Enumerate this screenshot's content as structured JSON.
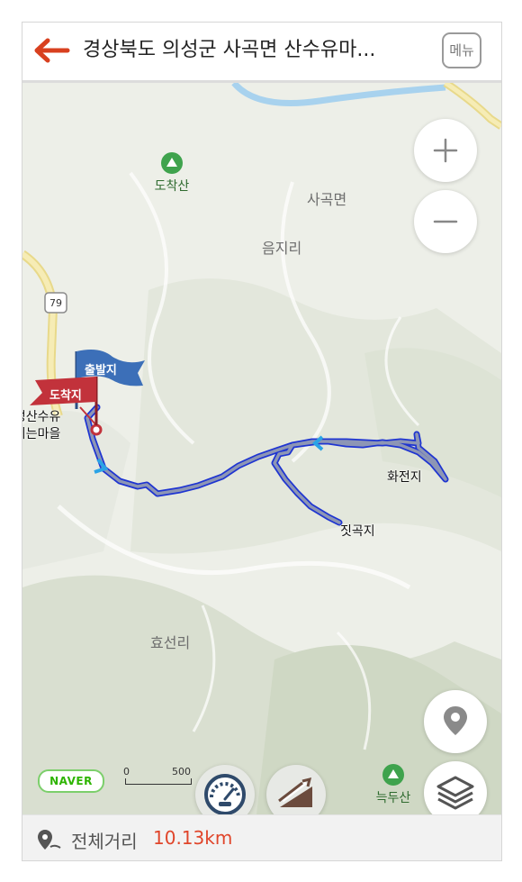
{
  "header": {
    "title": "경상북도 의성군 사곡면 산수유마...",
    "menu_label": "메뉴"
  },
  "map": {
    "area_labels": [
      "사곡면",
      "음지리",
      "효선리"
    ],
    "mountains": [
      "도착산",
      "늑두산"
    ],
    "road_number": "79",
    "route_places": {
      "origin": "의성산수유\n꽃피는마을",
      "hwajeonji": "화전지",
      "jitgokji": "짓곡지"
    },
    "flags": {
      "start": "출발지",
      "end": "도착지"
    },
    "scale": {
      "zero": "0",
      "value": "500"
    },
    "provider": "NAVER"
  },
  "controls": {
    "zoom_in": "+",
    "zoom_out": "−"
  },
  "footer": {
    "distance_label": "전체거리",
    "distance_value": "10.13km"
  },
  "colors": {
    "back_arrow": "#d8401f",
    "route": "#8d96b5",
    "route_outline": "#1f35d1",
    "flag_start": "#3c6fb8",
    "flag_end": "#c2323b",
    "distance": "#e0452a"
  }
}
